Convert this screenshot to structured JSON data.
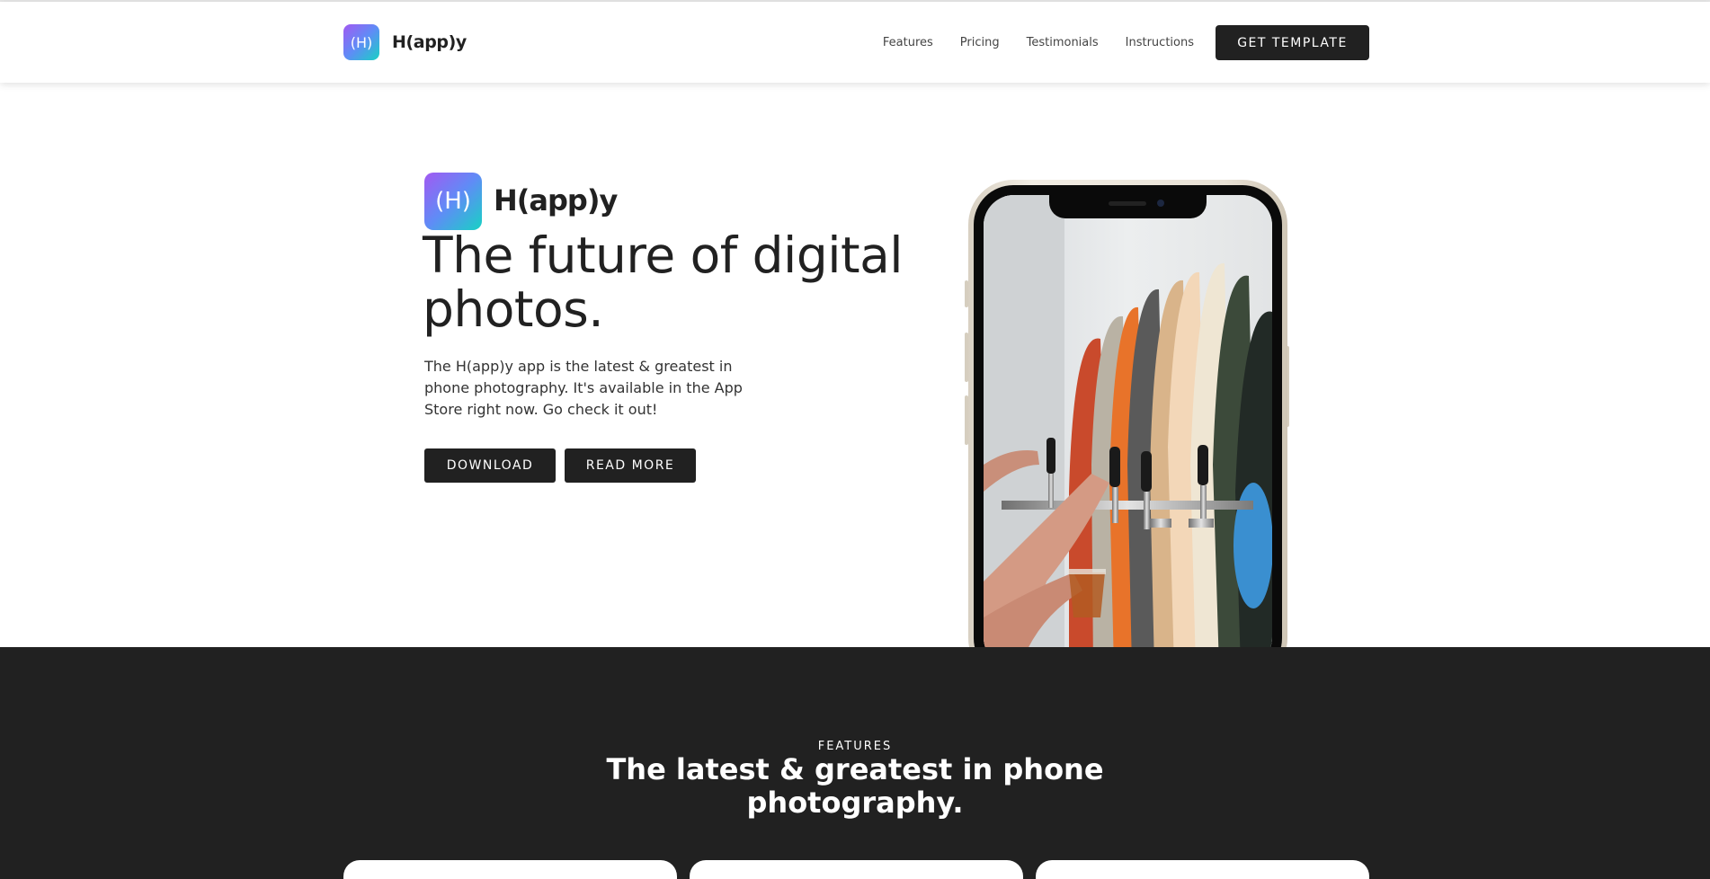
{
  "nav": {
    "logo_text": "(H)",
    "brand": "H(app)y",
    "links": [
      "Features",
      "Pricing",
      "Testimonials",
      "Instructions"
    ],
    "cta": "GET TEMPLATE"
  },
  "hero": {
    "logo_text": "(H)",
    "brand": "H(app)y",
    "title": "The future of digital photos.",
    "description": "The H(app)y app is the latest & greatest in phone photography. It's available in the App Store right now. Go check it out!",
    "buttons": [
      "DOWNLOAD",
      "READ MORE"
    ]
  },
  "features": {
    "kicker": "FEATURES",
    "title": "The latest & greatest in phone photography."
  },
  "colors": {
    "accent_gradient": [
      "#a259f2",
      "#5f8cf6",
      "#17d2c4"
    ],
    "dark": "#212121"
  }
}
